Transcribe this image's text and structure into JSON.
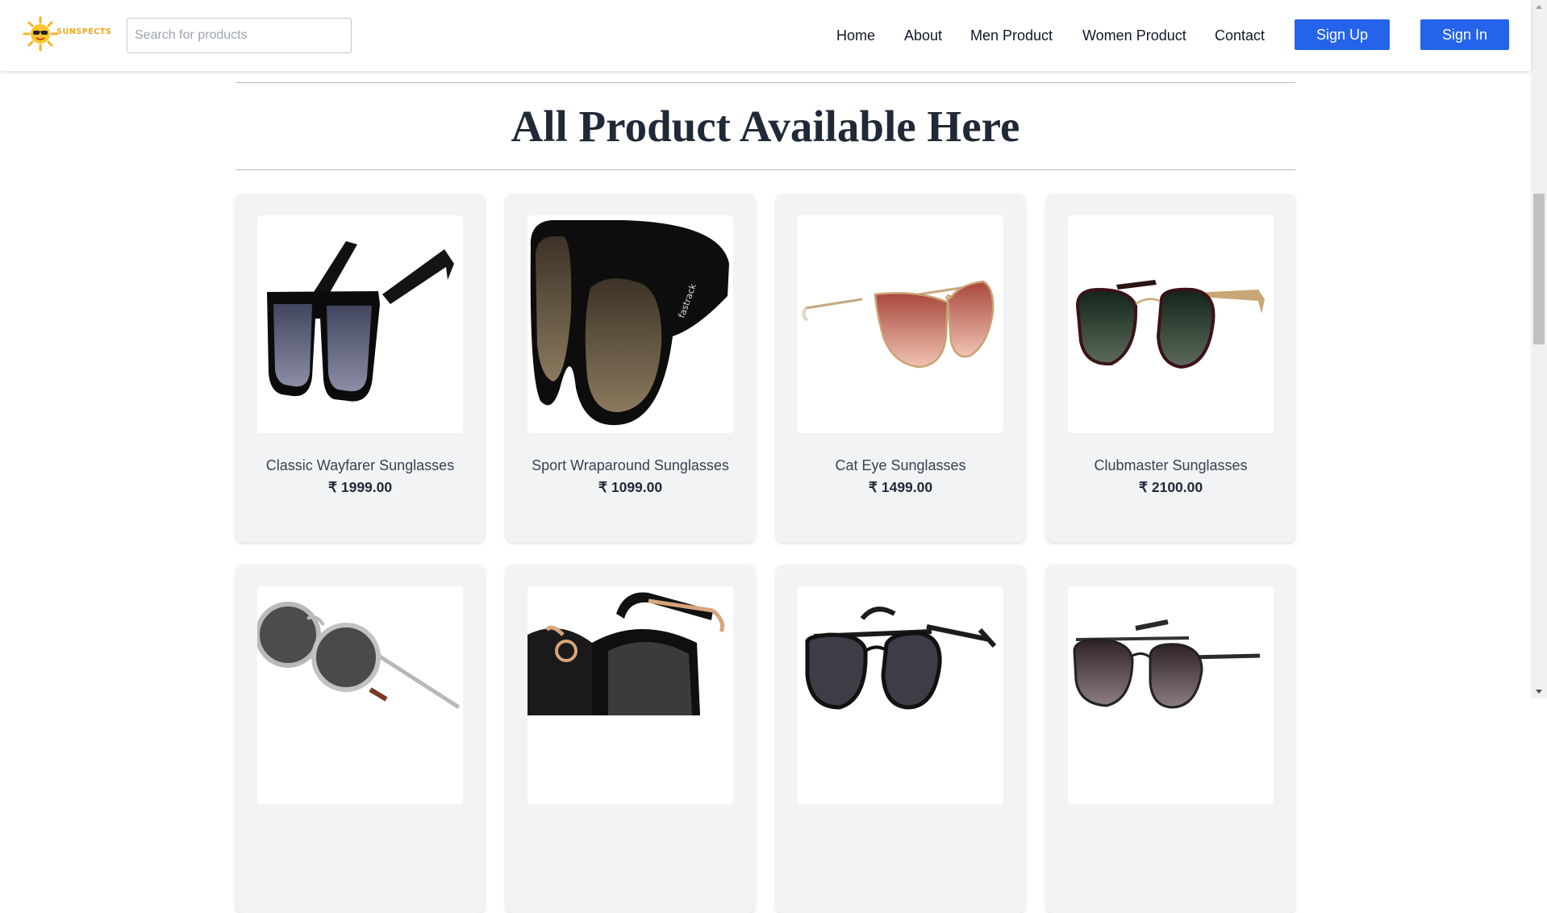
{
  "header": {
    "logo_text": "SUNSPECTS",
    "search_placeholder": "Search for products",
    "nav": [
      "Home",
      "About",
      "Men Product",
      "Women Product",
      "Contact"
    ],
    "signup_label": "Sign Up",
    "signin_label": "Sign In"
  },
  "main": {
    "title": "All Product Available Here",
    "products": [
      {
        "name": "Classic Wayfarer Sunglasses",
        "price": "₹ 1999.00"
      },
      {
        "name": "Sport Wraparound Sunglasses",
        "price": "₹ 1099.00"
      },
      {
        "name": "Cat Eye Sunglasses",
        "price": "₹ 1499.00"
      },
      {
        "name": "Clubmaster Sunglasses",
        "price": "₹ 2100.00"
      }
    ]
  },
  "colors": {
    "accent": "#2563eb",
    "logo": "#f2a51c",
    "card_bg": "#f2f3f5"
  }
}
